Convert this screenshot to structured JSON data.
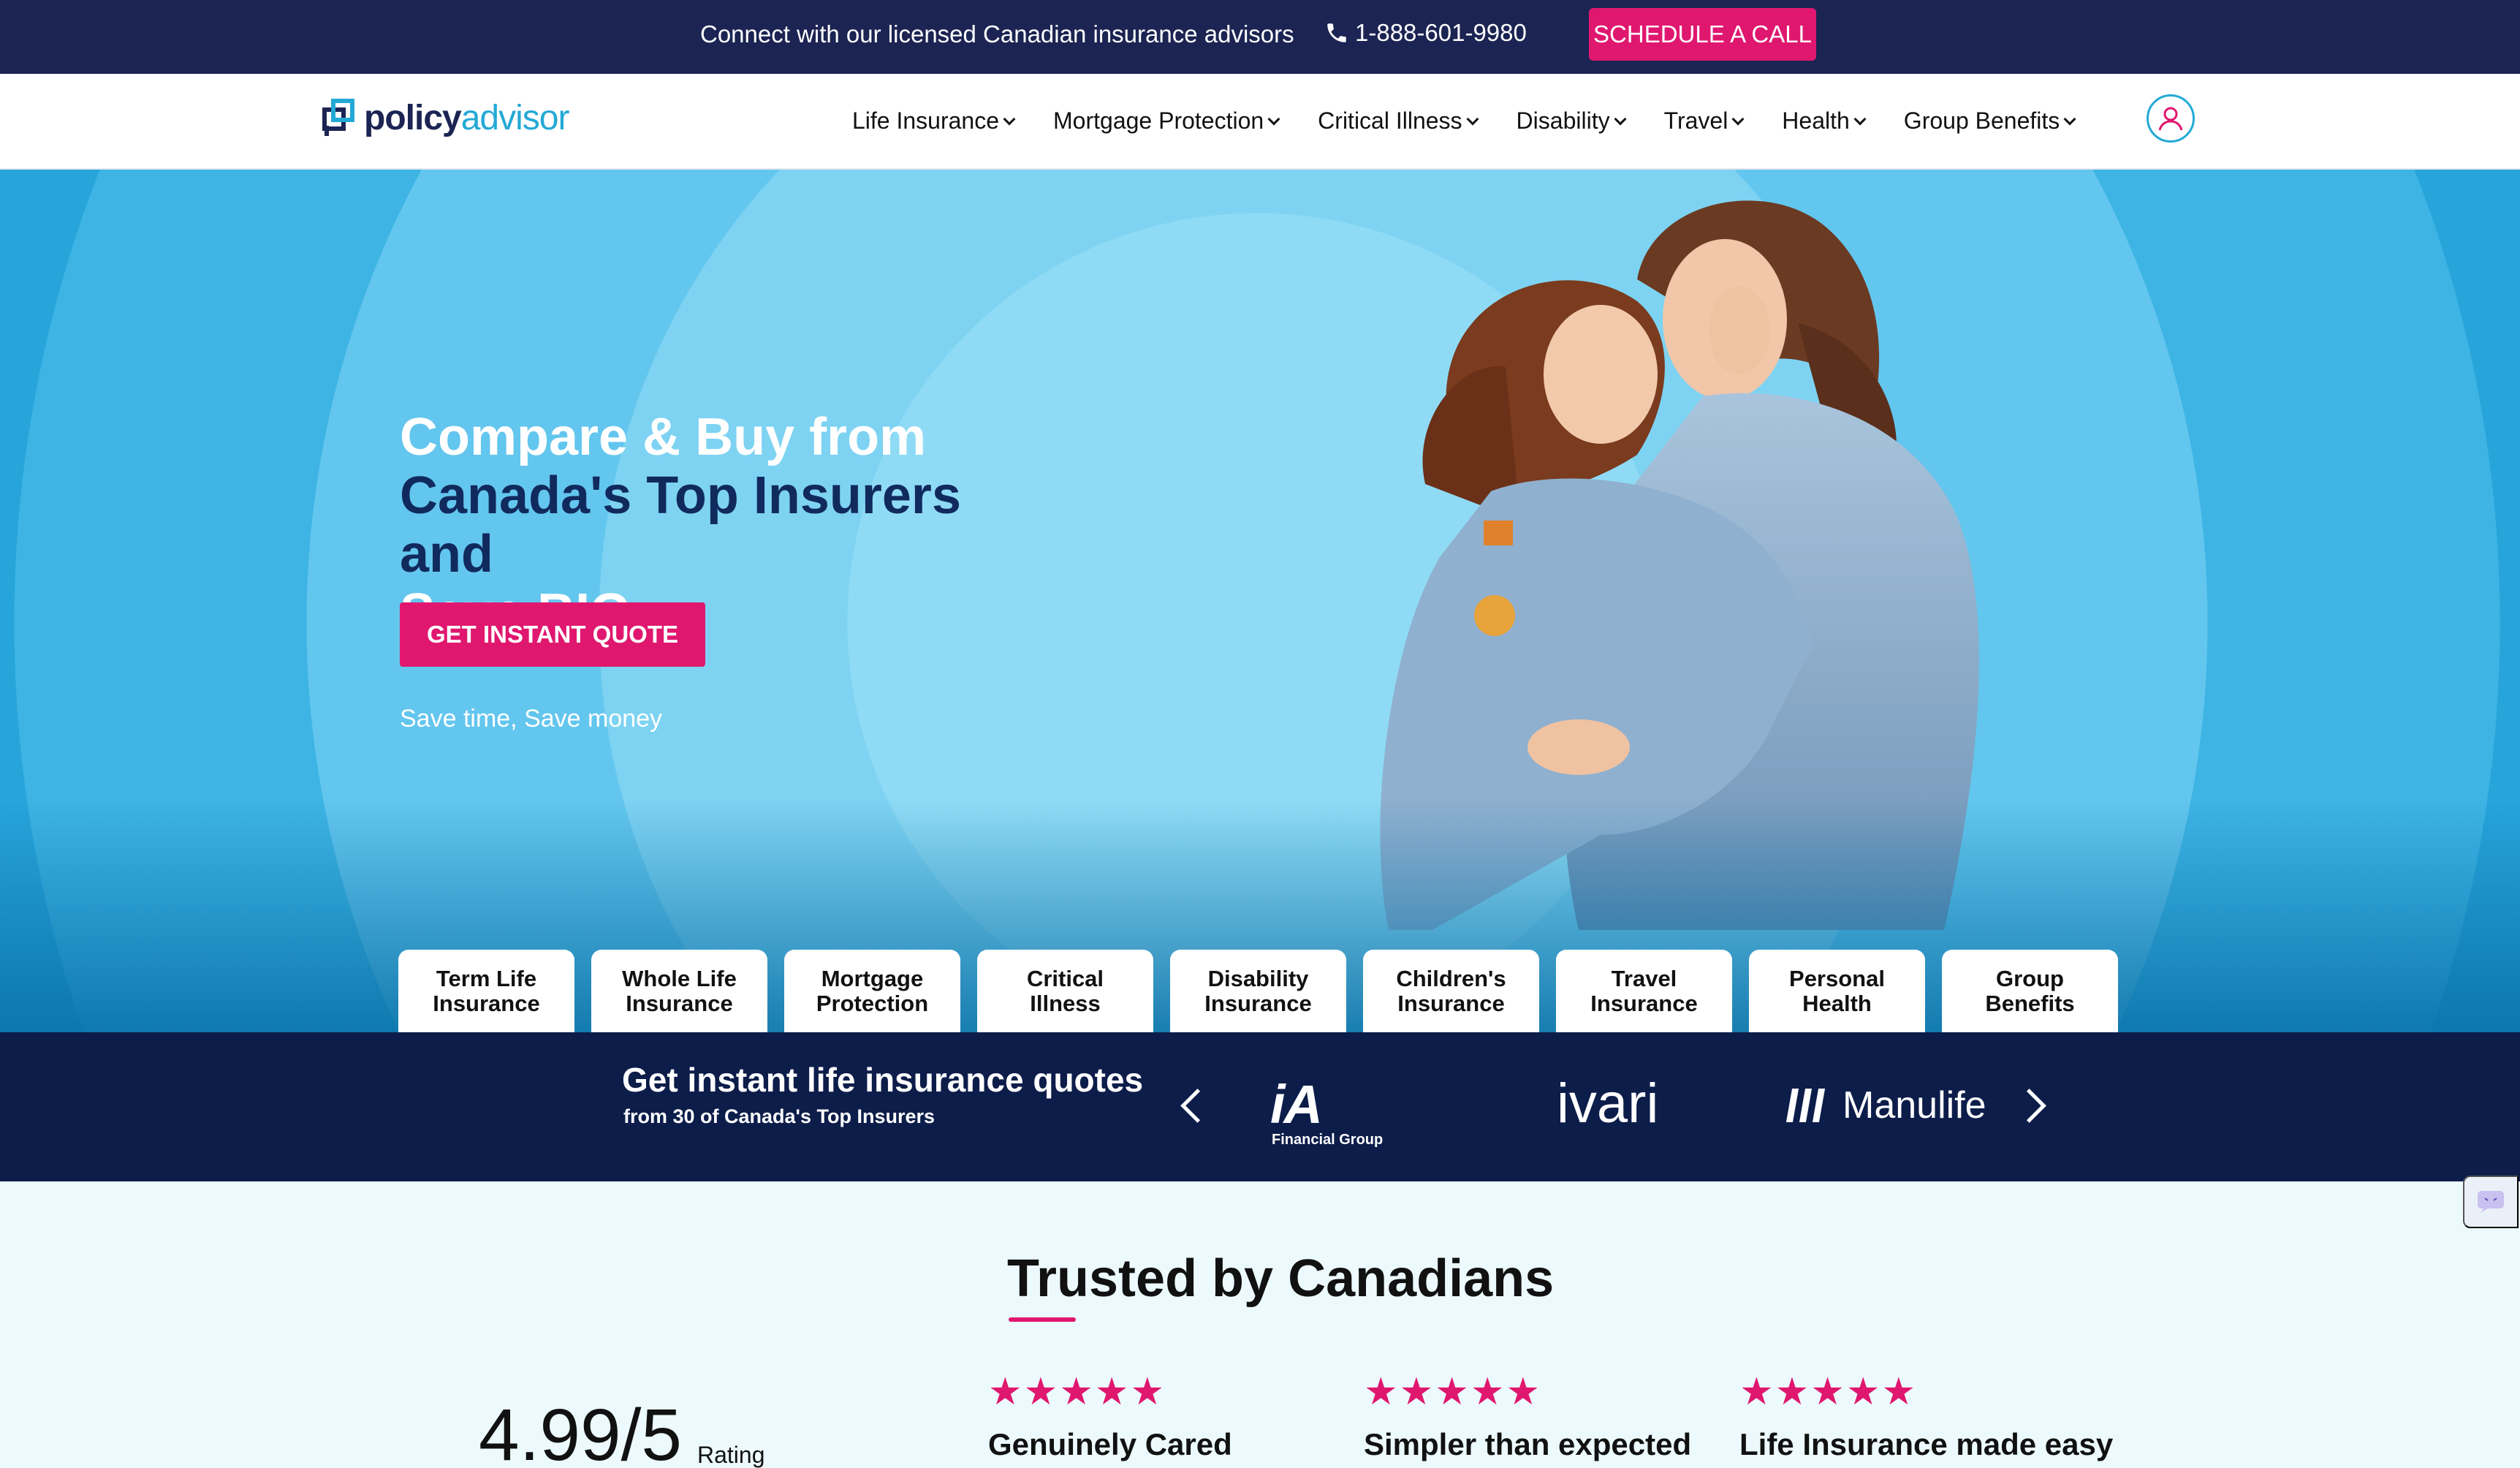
{
  "topbar": {
    "message": "Connect with our licensed Canadian insurance advisors",
    "phone": "1-888-601-9980",
    "schedule_label": "SCHEDULE A CALL"
  },
  "header": {
    "logo_part1": "policy",
    "logo_part2": "advisor",
    "menu": [
      {
        "label": "Life Insurance"
      },
      {
        "label": "Mortgage Protection"
      },
      {
        "label": "Critical Illness"
      },
      {
        "label": "Disability"
      },
      {
        "label": "Travel"
      },
      {
        "label": "Health"
      },
      {
        "label": "Group Benefits"
      }
    ]
  },
  "hero": {
    "title_line1": "Compare & Buy from",
    "title_line2": "Canada's Top Insurers and",
    "title_line3": "Save BIG",
    "cta_label": "GET INSTANT QUOTE",
    "tagline": "Save time, Save money"
  },
  "categories": [
    {
      "line1": "Term Life",
      "line2": "Insurance"
    },
    {
      "line1": "Whole Life",
      "line2": "Insurance"
    },
    {
      "line1": "Mortgage",
      "line2": "Protection"
    },
    {
      "line1": "Critical",
      "line2": "Illness"
    },
    {
      "line1": "Disability",
      "line2": "Insurance"
    },
    {
      "line1": "Children's",
      "line2": "Insurance"
    },
    {
      "line1": "Travel",
      "line2": "Insurance"
    },
    {
      "line1": "Personal",
      "line2": "Health"
    },
    {
      "line1": "Group",
      "line2": "Benefits"
    }
  ],
  "insurers": {
    "heading": "Get instant life insurance quotes",
    "subheading": "from 30 of Canada's Top Insurers",
    "logos": {
      "ia": "iA",
      "ia_sub": "Financial Group",
      "ivari": "ivari",
      "manulife": "Manulife"
    }
  },
  "trusted": {
    "heading": "Trusted by Canadians",
    "rating_value": "4.99/5",
    "rating_label": "Rating",
    "reviews": [
      {
        "stars": "★★★★★",
        "title": "Genuinely Cared"
      },
      {
        "stars": "★★★★★",
        "title": "Simpler than expected"
      },
      {
        "stars": "★★★★★",
        "title": "Life Insurance made easy"
      }
    ]
  },
  "colors": {
    "navy": "#1b2452",
    "accent_pink": "#e0176f",
    "brand_blue": "#23a9d6",
    "strip_navy": "#0d1d4a",
    "trusted_bg": "#edfafd"
  }
}
